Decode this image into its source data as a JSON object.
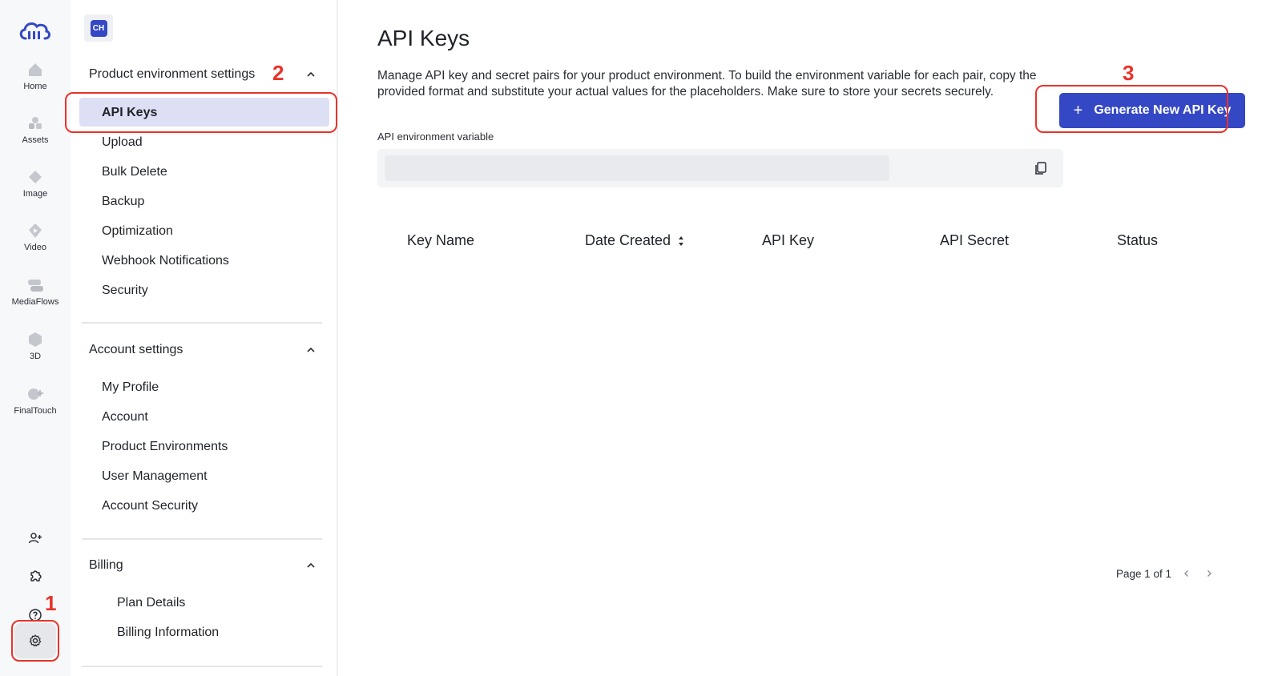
{
  "rail": {
    "items": [
      {
        "label": "Home",
        "icon": "home-icon"
      },
      {
        "label": "Assets",
        "icon": "assets-icon"
      },
      {
        "label": "Image",
        "icon": "image-icon"
      },
      {
        "label": "Video",
        "icon": "video-icon"
      },
      {
        "label": "MediaFlows",
        "icon": "mediaflows-icon"
      },
      {
        "label": "3D",
        "icon": "cube-icon"
      },
      {
        "label": "FinalTouch",
        "icon": "finaltouch-icon"
      }
    ],
    "bottom": [
      "invite-user-icon",
      "puzzle-icon",
      "help-icon",
      "gear-icon"
    ]
  },
  "sidebar": {
    "org_badge": "CH",
    "sections": [
      {
        "title": "Product environment settings",
        "items": [
          "API Keys",
          "Upload",
          "Bulk Delete",
          "Backup",
          "Optimization",
          "Webhook Notifications",
          "Security"
        ]
      },
      {
        "title": "Account settings",
        "items": [
          "My Profile",
          "Account",
          "Product Environments",
          "User Management",
          "Account Security"
        ]
      },
      {
        "title": "Billing",
        "items": [
          "Plan Details",
          "Billing Information"
        ]
      }
    ],
    "active_item": "API Keys"
  },
  "main": {
    "title": "API Keys",
    "description": "Manage API key and secret pairs for your product environment. To build the environment variable for each pair, copy the provided format and substitute your actual values for the placeholders. Make sure to store your secrets securely.",
    "generate_button": "Generate New API Key",
    "env_label": "API environment variable",
    "table_headers": [
      "Key Name",
      "Date Created",
      "API Key",
      "API Secret",
      "Status"
    ],
    "pagination": "Page 1 of 1"
  },
  "annotations": [
    "1",
    "2",
    "3"
  ],
  "colors": {
    "accent": "#3448c5",
    "active_bg": "#dde0f5",
    "annotation": "#e8332a"
  }
}
